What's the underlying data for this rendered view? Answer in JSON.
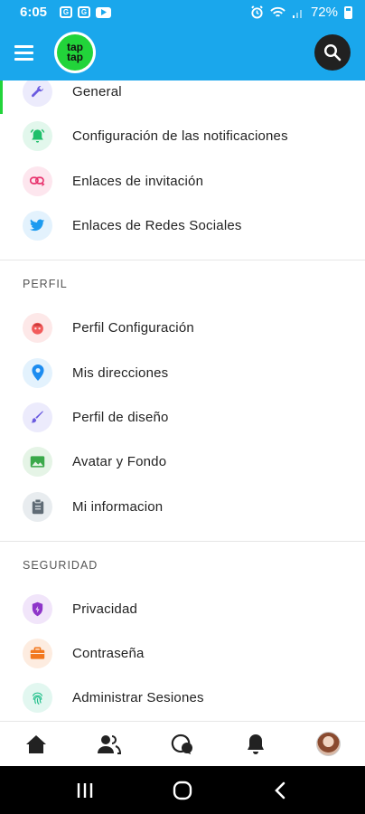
{
  "status_bar": {
    "time": "6:05",
    "battery": "72%"
  },
  "sections": [
    {
      "header": "",
      "items": [
        {
          "label": "General",
          "icon": "wrench-icon",
          "color": "#6a5be0",
          "bg": "#ecebfc"
        },
        {
          "label": "Configuración de las notificaciones",
          "icon": "bell-ring-icon",
          "color": "#1fbf6b",
          "bg": "#e2f7ec"
        },
        {
          "label": "Enlaces de invitación",
          "icon": "invite-link-icon",
          "color": "#e8356f",
          "bg": "#fde6ee"
        },
        {
          "label": "Enlaces de Redes Sociales",
          "icon": "twitter-icon",
          "color": "#1d9bf0",
          "bg": "#e3f2fd"
        }
      ]
    },
    {
      "header": "PERFIL",
      "items": [
        {
          "label": "Perfil Configuración",
          "icon": "profile-face-icon",
          "color": "#f25b5b",
          "bg": "#fde8e8"
        },
        {
          "label": "Mis direcciones",
          "icon": "location-pin-icon",
          "color": "#1d8cf0",
          "bg": "#e3f2fd"
        },
        {
          "label": "Perfil de diseño",
          "icon": "brush-icon",
          "color": "#6a5be0",
          "bg": "#ecebfc"
        },
        {
          "label": "Avatar y Fondo",
          "icon": "image-icon",
          "color": "#3ba94a",
          "bg": "#e5f4e6"
        },
        {
          "label": "Mi informacion",
          "icon": "clipboard-icon",
          "color": "#5f6b75",
          "bg": "#e8ecef"
        }
      ]
    },
    {
      "header": "SEGURIDAD",
      "items": [
        {
          "label": "Privacidad",
          "icon": "shield-icon",
          "color": "#8e35c9",
          "bg": "#f1e5fa"
        },
        {
          "label": "Contraseña",
          "icon": "briefcase-icon",
          "color": "#f2781e",
          "bg": "#fdece0"
        },
        {
          "label": "Administrar Sesiones",
          "icon": "fingerprint-icon",
          "color": "#1fbf8a",
          "bg": "#e2f7f0"
        }
      ]
    }
  ],
  "bottom_nav": [
    "home-icon",
    "people-icon",
    "chat-icon",
    "bell-icon",
    "avatar"
  ],
  "colors": {
    "app_bar": "#1aa7ec",
    "active_indicator": "#22d43a"
  }
}
